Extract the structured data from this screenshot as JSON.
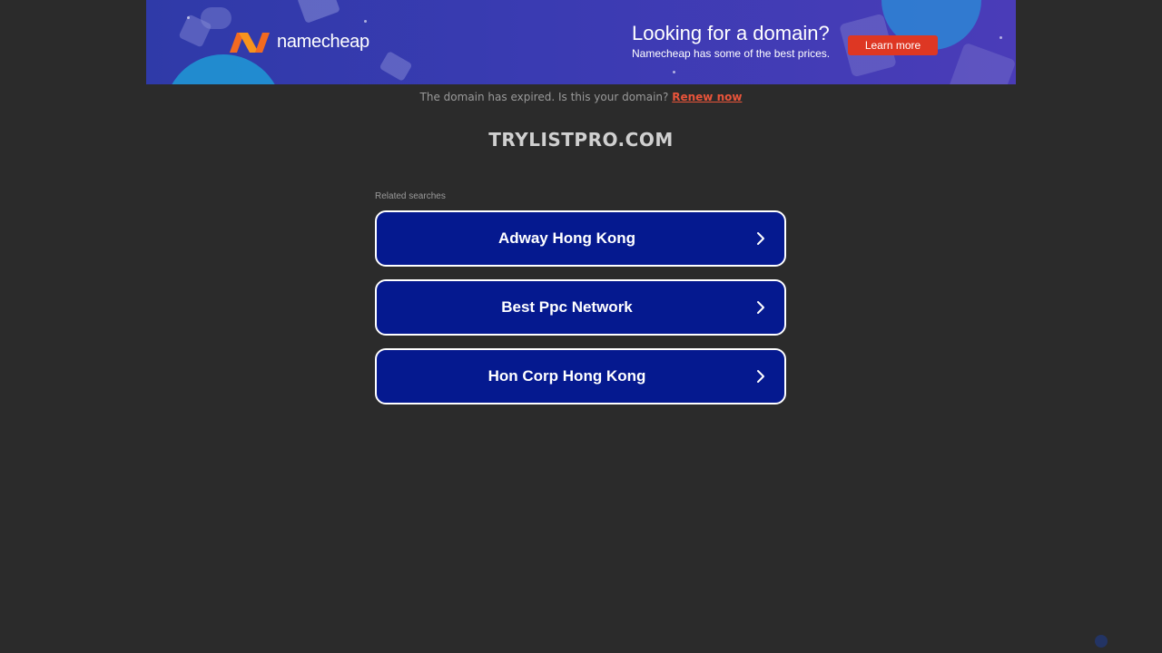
{
  "banner": {
    "brand": "namecheap",
    "title": "Looking for a domain?",
    "subtitle": "Namecheap has some of the best prices.",
    "cta_label": "Learn more",
    "colors": {
      "background": "#3a3bb2",
      "cta": "#de3723",
      "logo": "#f26a21"
    }
  },
  "notice": {
    "text": "The domain has expired. Is this your domain?",
    "link_label": "Renew now",
    "link_color": "#e8543a"
  },
  "domain": {
    "name": "TRYLISTPRO.COM"
  },
  "related": {
    "label": "Related searches",
    "items": [
      {
        "label": "Adway Hong Kong",
        "icon": "chevron-right-icon"
      },
      {
        "label": "Best Ppc Network",
        "icon": "chevron-right-icon"
      },
      {
        "label": "Hon Corp Hong Kong",
        "icon": "chevron-right-icon"
      }
    ],
    "colors": {
      "button_bg": "#05198f",
      "button_border": "#ffffff"
    }
  },
  "page": {
    "background": "#2b2b2b"
  }
}
